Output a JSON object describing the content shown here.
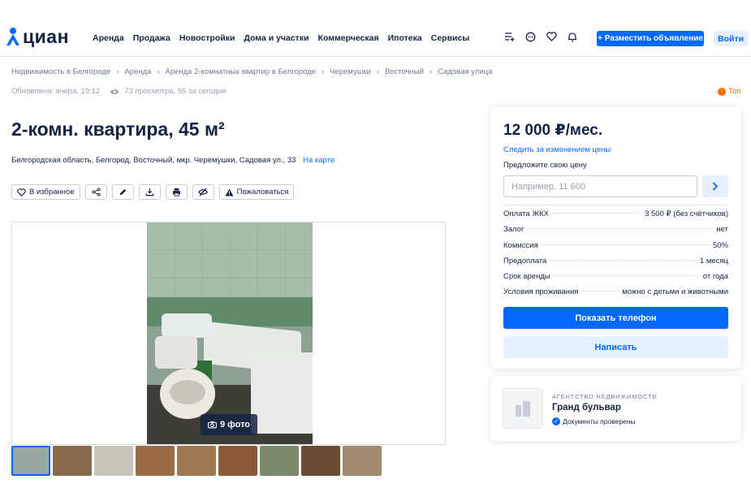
{
  "header": {
    "logo_text": "циан",
    "nav": [
      "Аренда",
      "Продажа",
      "Новостройки",
      "Дома и участки",
      "Коммерческая",
      "Ипотека",
      "Сервисы"
    ],
    "icons": [
      "compare-list-icon",
      "chat-icon",
      "heart-icon",
      "bell-icon"
    ],
    "post_button": "+ Разместить объявление",
    "login_button": "Войти"
  },
  "breadcrumbs": [
    "Недвижимость в Белгороде",
    "Аренда",
    "Аренда 2-комнатных квартир в Белгороде",
    "Черемушки",
    "Восточный",
    "Садовая улица"
  ],
  "meta": {
    "updated": "Обновлено: вчера, 19:12",
    "views": "73 просмотра, 55 за сегодня"
  },
  "top_badge": "Топ",
  "listing": {
    "title": "2-комн. квартира, 45 м²",
    "address": "Белгородская область, Белгород, Восточный, мкр. Черемушки, Садовая ул., 33",
    "map_link": "На карте"
  },
  "actions": {
    "favorite": "В избранное",
    "report": "Пожаловаться"
  },
  "gallery": {
    "photo_count_label": "9 фото",
    "thumb_colors": [
      "#9aa8a4",
      "#8a6a4c",
      "#c8c4b8",
      "#9a6a44",
      "#a07a54",
      "#8a5a3a",
      "#7a8a6a",
      "#6a4a30",
      "#a08a70"
    ]
  },
  "price_card": {
    "price": "12 000 ₽/мес.",
    "follow_price": "Следить за изменением цены",
    "offer_label": "Предложите свою цену",
    "offer_placeholder": "Например, 11 600",
    "terms": [
      {
        "label": "Оплата ЖКХ",
        "value": "3 500 ₽ (без счётчиков)"
      },
      {
        "label": "Залог",
        "value": "нет"
      },
      {
        "label": "Комиссия",
        "value": "50%"
      },
      {
        "label": "Предоплата",
        "value": "1 месяц"
      },
      {
        "label": "Срок аренды",
        "value": "от года"
      },
      {
        "label": "Условия проживания",
        "value": "можно с детьми и животными"
      }
    ],
    "show_phone": "Показать телефон",
    "write": "Написать"
  },
  "agent": {
    "type": "АГЕНТСТВО НЕДВИЖИМОСТИ",
    "name": "Гранд бульвар",
    "verified": "Документы проверены"
  },
  "colors": {
    "accent": "#0468ff",
    "top": "#ff6a00",
    "text": "#152242"
  }
}
